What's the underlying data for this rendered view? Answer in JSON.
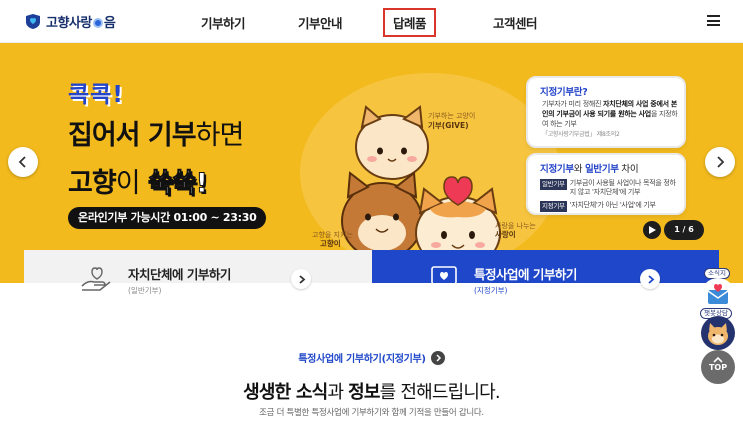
{
  "header": {
    "logo_text_1": "고향사랑",
    "logo_text_2": "음",
    "nav": [
      {
        "label": "기부하기"
      },
      {
        "label": "기부안내"
      },
      {
        "label": "답례품"
      },
      {
        "label": "고객센터"
      }
    ],
    "active_nav": "답례품"
  },
  "hero": {
    "badge": "콕콕!",
    "line1_bold": "집어서 기부",
    "line1_thin": "하면",
    "line2_bold": "고향",
    "line2_thin": "이",
    "line2_accent": "쑥쑥!",
    "hours": "온라인기부 가능시간 01:00 ~ 23:30",
    "char_labels": {
      "give_sub": "기부하는 고양이",
      "give": "기부(GIVE)",
      "home_sub": "고향을 지키는",
      "home": "고향이",
      "love_sub": "사랑을 나누는",
      "love": "사랑이"
    },
    "card1": {
      "title": "지정기부란?",
      "body_pre": "기부자가 미리 정해진 ",
      "body_bold": "자치단체의 사업 중에서 본인의 기부금이 사용 되기를 원하는 사업",
      "body_post": "을 지정하여 하는 기부",
      "ref": "「고향사랑기부금법」 제8조의2"
    },
    "card2": {
      "title_a": "지정기부",
      "title_and": "와 ",
      "title_b": "일반기부",
      "title_end": " 차이",
      "row1_tag": "일반기부",
      "row1_text": "기부금이 사용될 사업이나 목적을 정하지 않고 '자치단체'에 기부",
      "row2_tag": "지정기부",
      "row2_text": "'자치단체'가 아닌 '사업'에 기부"
    },
    "pager": "1 / 6",
    "colors": {
      "background": "#f3ba1e",
      "accent": "#2545c9"
    }
  },
  "donate": {
    "left_label": "자치단체에 기부하기",
    "left_sub": "(일반기부)",
    "right_label": "특정사업에 기부하기",
    "right_sub": "(지정기부)",
    "right_color": "#1f47c9"
  },
  "content": {
    "section_link": "특정사업에 기부하기(지정기부)",
    "headline_b1": "생생한 소식",
    "headline_mid": "과 ",
    "headline_b2": "정보",
    "headline_end": "를 전해드립니다.",
    "subline": "조금 더 특별한 특정사업에 기부하기와 함께 기적을 만들어 갑니다."
  },
  "floating": {
    "news_tag": "소식지",
    "chat_tag": "챗봇상담",
    "top_label": "TOP"
  }
}
